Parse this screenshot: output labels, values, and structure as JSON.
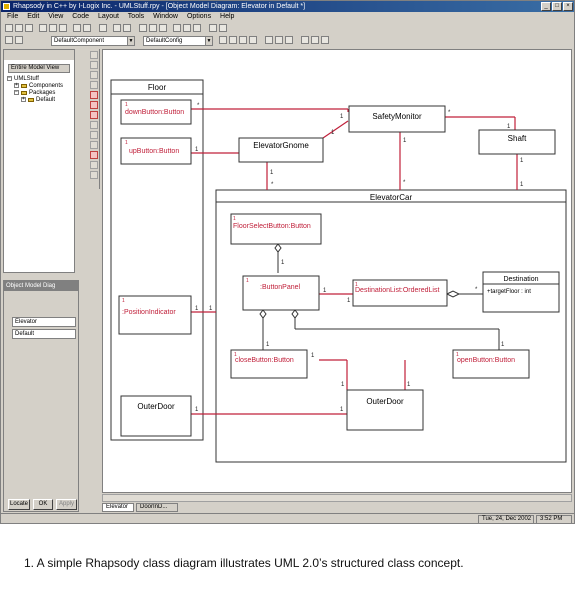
{
  "window": {
    "title": "Rhapsody in C++ by I-Logix Inc. - UMLStuff.rpy - [Object Model Diagram: Elevator in Default *]"
  },
  "menu": [
    "File",
    "Edit",
    "View",
    "Code",
    "Layout",
    "Tools",
    "Window",
    "Options",
    "Help"
  ],
  "toolbar": {
    "component_combo": "DefaultComponent",
    "config_combo": "DefaultConfig"
  },
  "browser": {
    "view_combo": "Entire Model View",
    "tree": {
      "root": "UMLStuff",
      "components": "Components",
      "packages": "Packages",
      "default": "Default"
    }
  },
  "omd_panel": {
    "title": "Object Model Diag",
    "field1": "Elevator",
    "field2": "Default",
    "buttons": [
      "Locate",
      "OK",
      "Apply"
    ]
  },
  "diagram": {
    "floor": {
      "name": "Floor"
    },
    "down_button": {
      "name": "downButton:Button",
      "mult": "1"
    },
    "up_button": {
      "name": "upButton:Button",
      "mult": "1"
    },
    "elevator_gnome": {
      "name": "ElevatorGnome"
    },
    "safety_monitor": {
      "name": "SafetyMonitor"
    },
    "shaft": {
      "name": "Shaft"
    },
    "elevator_car": {
      "name": "ElevatorCar"
    },
    "floor_select_button": {
      "name": "FloorSelectButton:Button",
      "mult": "1"
    },
    "button_panel": {
      "name": ":ButtonPanel",
      "mult": "1"
    },
    "destination_list": {
      "name": "DestinationList:OrderedList",
      "mult": "1"
    },
    "destination": {
      "name": "Destination",
      "attr": "+targetFloor : int"
    },
    "position_indicator": {
      "name": ":PositionIndicator",
      "mult": "1"
    },
    "close_button": {
      "name": "closeButton:Button",
      "mult": "1"
    },
    "open_button": {
      "name": "openButton:Button",
      "mult": "1"
    },
    "outer_door_floor": {
      "name": "OuterDoor"
    },
    "outer_door_car": {
      "name": "OuterDoor"
    },
    "mult_star": "*",
    "mult_one": "1"
  },
  "tabs": [
    "Elevator",
    "DoorInD..."
  ],
  "status": {
    "date": "Tue, 24, Dec 2002",
    "time": "3:52 PM"
  },
  "caption": "1. A simple Rhapsody class diagram illustrates UML 2.0’s structured class concept.",
  "colors": {
    "title_bar": "#0a246a",
    "assoc_line": "#c0203a",
    "node_border": "#333333",
    "window_bg": "#d4d0c8"
  }
}
